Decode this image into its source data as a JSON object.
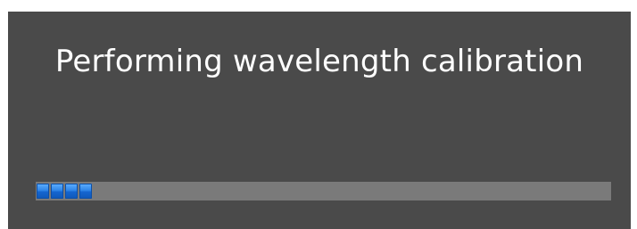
{
  "dialog": {
    "title": "Performing wavelength calibration"
  },
  "progress": {
    "value_fraction": 0.1,
    "segments_filled": 4,
    "accent_color": "#2f86e8",
    "track_color": "#7a7a7a",
    "background_color": "#4a4a4a"
  }
}
